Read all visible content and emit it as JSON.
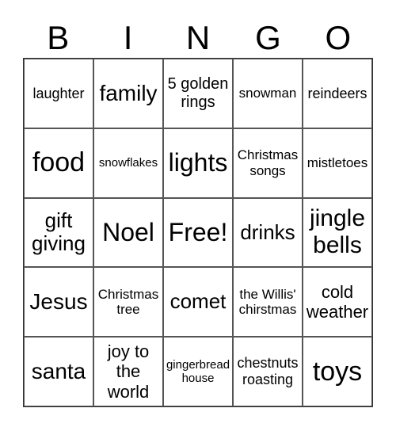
{
  "header": [
    "B",
    "I",
    "N",
    "G",
    "O"
  ],
  "cells": [
    {
      "text": "laughter",
      "size": "s18"
    },
    {
      "text": "family",
      "size": "s28"
    },
    {
      "text": "5 golden rings",
      "size": "s20"
    },
    {
      "text": "snowman",
      "size": "s17"
    },
    {
      "text": "reindeers",
      "size": "s18"
    },
    {
      "text": "food",
      "size": "s34"
    },
    {
      "text": "snowflakes",
      "size": "s15"
    },
    {
      "text": "lights",
      "size": "s32"
    },
    {
      "text": "Christmas songs",
      "size": "s17"
    },
    {
      "text": "mistletoes",
      "size": "s17"
    },
    {
      "text": "gift giving",
      "size": "s26"
    },
    {
      "text": "Noel",
      "size": "s32"
    },
    {
      "text": "Free!",
      "size": "s32"
    },
    {
      "text": "drinks",
      "size": "s26"
    },
    {
      "text": "jingle bells",
      "size": "s30"
    },
    {
      "text": "Jesus",
      "size": "s28"
    },
    {
      "text": "Christmas tree",
      "size": "s17"
    },
    {
      "text": "comet",
      "size": "s26"
    },
    {
      "text": "the Willis' chirstmas",
      "size": "s17"
    },
    {
      "text": "cold weather",
      "size": "s22"
    },
    {
      "text": "santa",
      "size": "s28"
    },
    {
      "text": "joy to the world",
      "size": "s22"
    },
    {
      "text": "gingerbread house",
      "size": "s15"
    },
    {
      "text": "chestnuts roasting",
      "size": "s18"
    },
    {
      "text": "toys",
      "size": "s34"
    }
  ]
}
